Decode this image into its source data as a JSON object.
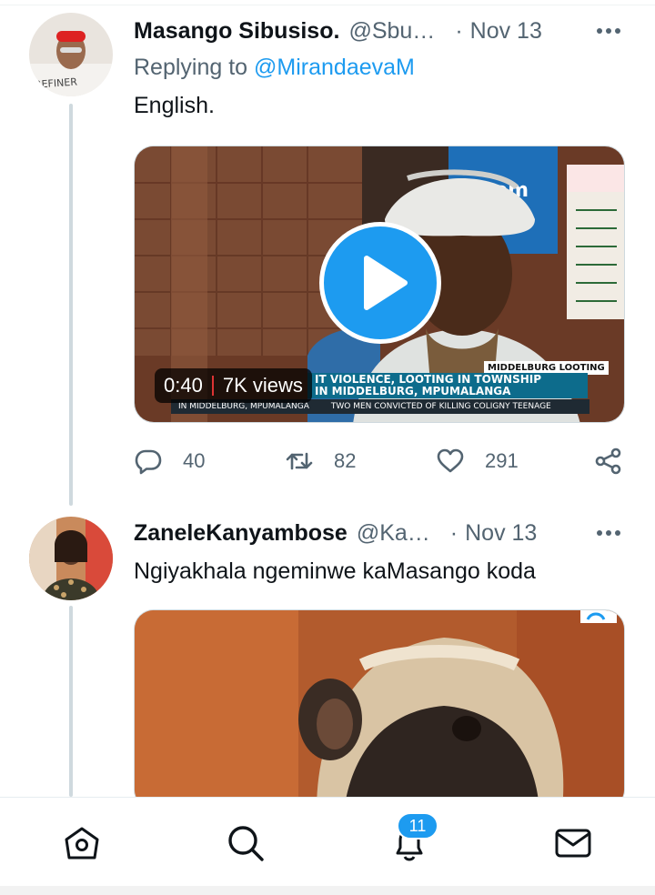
{
  "tweets": [
    {
      "display_name": "Masango Sibusiso.",
      "handle": "@Sbu…",
      "separator": "·",
      "date": "Nov 13",
      "reply_prefix": "Replying to ",
      "reply_handle": "@MirandaevaM",
      "text": "English.",
      "avatar_icon": "profile-photo",
      "video": {
        "duration": "0:40",
        "views": "7K views",
        "ticker_tag": "MIDDELBURG LOOTING",
        "ticker_line1": "IT VIOLENCE, LOOTING IN TOWNSHIP",
        "ticker_line2": "IN MIDDELBURG, MPUMALANGA",
        "ticker_bottom_left": "IN MIDDELBURG, MPUMALANGA",
        "ticker_bottom_right": "TWO MEN CONVICTED OF KILLING COLIGNY TEENAGE"
      },
      "actions": {
        "replies": "40",
        "retweets": "82",
        "likes": "291"
      }
    },
    {
      "display_name": "ZaneleKanyambose",
      "handle": "@Ka…",
      "separator": "·",
      "date": "Nov 13",
      "text": "Ngiyakhala ngeminwe kaMasango koda",
      "avatar_icon": "profile-photo"
    }
  ],
  "bottom_nav": {
    "items": [
      "home-icon",
      "search-icon",
      "notifications-bell-icon",
      "messages-envelope-icon"
    ],
    "notification_badge": "11"
  },
  "colors": {
    "accent": "#1d9bf0",
    "muted_text": "#536471",
    "primary_text": "#0f1419"
  }
}
